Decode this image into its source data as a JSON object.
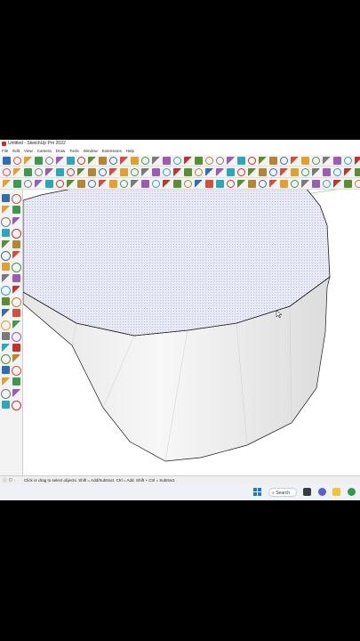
{
  "window": {
    "title": "Untitled - SketchUp Pro 2022"
  },
  "menu": [
    "File",
    "Edit",
    "View",
    "Camera",
    "Draw",
    "Tools",
    "Window",
    "Extensions",
    "Help"
  ],
  "toolbars": {
    "row1": [
      "select-icon",
      "eraser-icon",
      "paint-bucket-icon",
      "orbit-icon",
      "pan-icon",
      "zoom-icon",
      "line-icon",
      "arc-icon",
      "rectangle-icon",
      "circle-icon",
      "polygon-icon",
      "push-pull-icon",
      "move-icon",
      "rotate-icon",
      "scale-icon",
      "offset-icon",
      "tape-measure-icon",
      "text-icon",
      "axes-icon",
      "protractor-icon"
    ],
    "row2": [
      "iso-view-icon",
      "top-view-icon",
      "front-view-icon",
      "right-view-icon",
      "back-view-icon",
      "left-view-icon",
      "xray-icon",
      "wireframe-icon",
      "hidden-line-icon",
      "shaded-icon",
      "textured-icon",
      "monochrome-icon",
      "section-plane-icon",
      "section-cut-icon",
      "component-icon",
      "group-icon",
      "follow-me-icon",
      "outliner-icon",
      "layers-icon",
      "styles-icon"
    ],
    "row3": [
      "sandbox-icon",
      "smoove-icon",
      "stamp-icon",
      "drape-icon",
      "flip-edge-icon",
      "warehouse-icon",
      "extension-icon",
      "solid-union-icon",
      "solid-subtract-icon",
      "solid-trim-icon",
      "solid-intersect-icon",
      "solid-split-icon",
      "outer-shell-icon",
      "position-camera-icon",
      "walk-icon",
      "look-around-icon",
      "dimension-icon",
      "pie-icon",
      "shadow-icon",
      "fog-icon"
    ]
  },
  "left_tools": [
    "select-icon",
    "make-component-icon",
    "paint-bucket-icon",
    "eraser-icon",
    "tag-icon",
    "lock-icon",
    "line-icon",
    "freehand-icon",
    "rectangle-icon",
    "rotated-rectangle-icon",
    "circle-icon",
    "polygon-icon",
    "arc-icon",
    "two-point-arc-icon",
    "pie-icon",
    "three-point-arc-icon",
    "move-icon",
    "push-pull-icon",
    "rotate-icon",
    "follow-me-icon",
    "scale-icon",
    "offset-icon",
    "tape-measure-icon",
    "dimension-icon",
    "protractor-icon",
    "text-icon",
    "axes-icon",
    "3d-text-icon",
    "orbit-icon",
    "pan-icon",
    "zoom-icon",
    "zoom-window-icon",
    "zoom-extents-icon",
    "previous-view-icon",
    "position-camera-icon",
    "look-around-icon",
    "walk-icon",
    "section-plane-icon"
  ],
  "status": {
    "text": "Click or drag to select objects. Shift = Add/Subtract. Ctrl = Add. Shift + Ctrl = Subtract."
  },
  "taskbar": {
    "search_label": "Search"
  },
  "colors": {
    "face_top": "#e2e4f3",
    "face_side": "#f0f0f0",
    "edge": "#1a1a1a",
    "accent": "#1a78d6"
  }
}
